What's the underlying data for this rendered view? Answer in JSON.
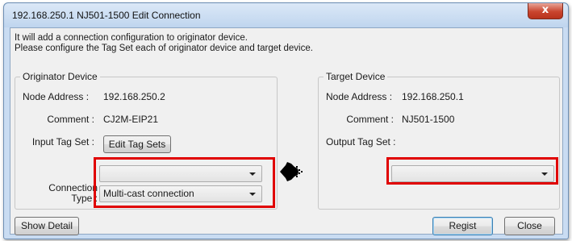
{
  "window": {
    "title": "192.168.250.1 NJ501-1500 Edit Connection",
    "close_label": "x"
  },
  "description": {
    "line1": "It will add a connection configuration to originator device.",
    "line2": "Please configure the Tag Set each of originator device and target device."
  },
  "originator": {
    "group_title": "Originator Device",
    "node_address_label": "Node Address :",
    "node_address_value": "192.168.250.2",
    "comment_label": "Comment :",
    "comment_value": "CJ2M-EIP21",
    "input_tag_set_label": "Input Tag Set :",
    "edit_tag_sets_label": "Edit Tag Sets",
    "input_tag_set_value": "",
    "connection_type_label_line1": "Connection",
    "connection_type_label_line2": "Type :",
    "connection_type_value": "Multi-cast connection"
  },
  "target": {
    "group_title": "Target Device",
    "node_address_label": "Node Address :",
    "node_address_value": "192.168.250.1",
    "comment_label": "Comment :",
    "comment_value": "NJ501-1500",
    "output_tag_set_label": "Output Tag Set :",
    "output_tag_set_value": ""
  },
  "footer": {
    "show_detail_label": "Show Detail",
    "regist_label": "Regist",
    "close_label": "Close"
  },
  "colors": {
    "highlight_box": "#e00000",
    "title_bar": "#c9dcf2",
    "dialog_body": "#f0f0f0"
  }
}
